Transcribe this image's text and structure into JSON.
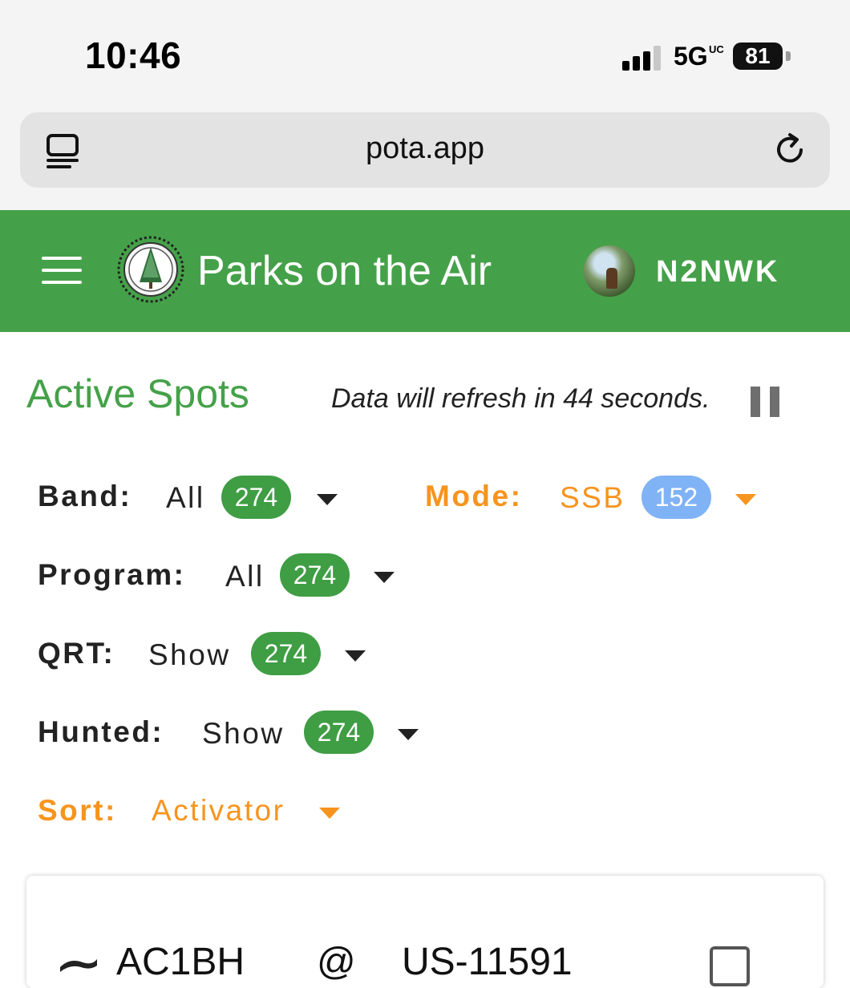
{
  "status_bar": {
    "time": "10:46",
    "network": "5G",
    "network_suffix": "UC",
    "battery": "81"
  },
  "browser": {
    "url": "pota.app"
  },
  "header": {
    "title": "Parks on the Air",
    "username": "N2NWK",
    "bg_color": "#45a149"
  },
  "spots": {
    "title": "Active Spots",
    "refresh_text": "Data will refresh in 44 seconds."
  },
  "filters": {
    "band": {
      "label": "Band:",
      "value": "All",
      "count": "274"
    },
    "mode": {
      "label": "Mode:",
      "value": "SSB",
      "count": "152"
    },
    "program": {
      "label": "Program:",
      "value": "All",
      "count": "274"
    },
    "qrt": {
      "label": "QRT:",
      "value": "Show",
      "count": "274"
    },
    "hunted": {
      "label": "Hunted:",
      "value": "Show",
      "count": "274"
    },
    "sort": {
      "label": "Sort:",
      "value": "Activator"
    }
  },
  "first_spot": {
    "activator": "AC1BH",
    "at": "@",
    "park": "US-11591"
  },
  "colors": {
    "accent_green": "#45a149",
    "accent_orange": "#f7941d",
    "pill_green": "#3f9d44",
    "pill_blue": "#80b2f6"
  }
}
